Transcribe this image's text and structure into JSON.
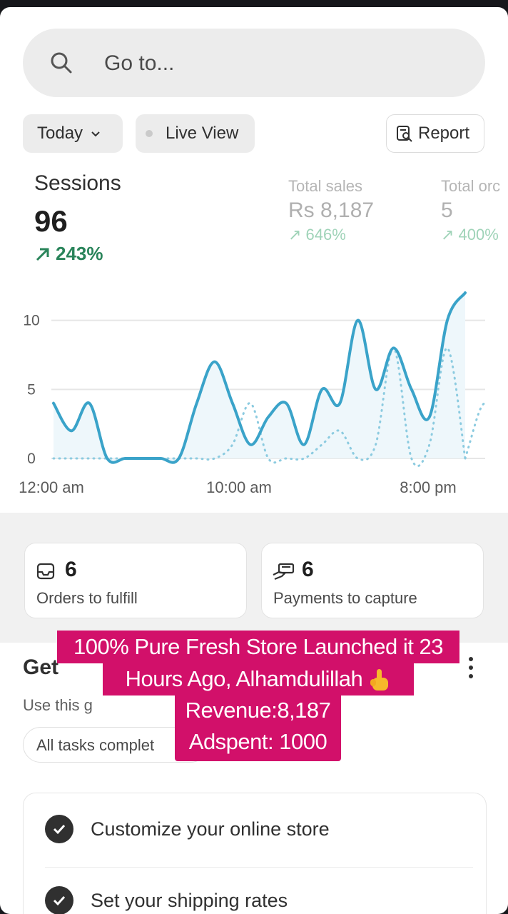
{
  "search": {
    "placeholder": "Go to..."
  },
  "filters": {
    "date_label": "Today",
    "live_view_label": "Live View",
    "report_label": "Report"
  },
  "metrics": {
    "sessions": {
      "title": "Sessions",
      "value": "96",
      "change": "243%"
    },
    "total_sales": {
      "title": "Total sales",
      "value": "Rs 8,187",
      "change": "646%"
    },
    "total_orders": {
      "title": "Total orc",
      "value": "5",
      "change": "400%"
    }
  },
  "chart_data": {
    "type": "line",
    "y_ticks": [
      "10",
      "5",
      "0"
    ],
    "x_ticks": [
      "12:00 am",
      "10:00 am",
      "8:00 pm"
    ],
    "ylim": [
      0,
      12
    ],
    "x": [
      0,
      1,
      2,
      3,
      4,
      5,
      6,
      7,
      8,
      9,
      10,
      11,
      12,
      13,
      14,
      15,
      16,
      17,
      18,
      19,
      20,
      21,
      22,
      23
    ],
    "series": [
      {
        "style": "solid",
        "color": "#3aa3c9",
        "values": [
          4,
          2,
          4,
          0,
          0,
          0,
          0,
          0,
          4,
          7,
          4,
          1,
          3,
          4,
          1,
          5,
          4,
          10,
          5,
          8,
          5,
          3,
          10,
          12
        ]
      },
      {
        "style": "dotted",
        "color": "#8ccbe0",
        "values": [
          0,
          0,
          0,
          0,
          0,
          0,
          0,
          0,
          0,
          0,
          1,
          4,
          0,
          0,
          0,
          1,
          2,
          0,
          1,
          8,
          0,
          1,
          8,
          0
        ]
      }
    ]
  },
  "todo_cards": [
    {
      "count": "6",
      "label": "Orders to fulfill",
      "icon": "inbox-icon"
    },
    {
      "count": "6",
      "label": "Payments to capture",
      "icon": "hand-cash-icon"
    }
  ],
  "guide": {
    "title": "Get",
    "description": "Use this g",
    "tasks_chip": "All tasks complet",
    "tasks": [
      "Customize your online store",
      "Set your shipping rates"
    ]
  },
  "overlay": {
    "line1": "100% Pure Fresh Store Launched it 23",
    "line2": "Hours Ago, Alhamdulillah",
    "line3": "Revenue:8,187",
    "line4": "Adspent: 1000"
  },
  "colors": {
    "accent_green": "#29845a",
    "overlay_pink": "#d2106a",
    "chart_blue": "#3aa3c9"
  }
}
